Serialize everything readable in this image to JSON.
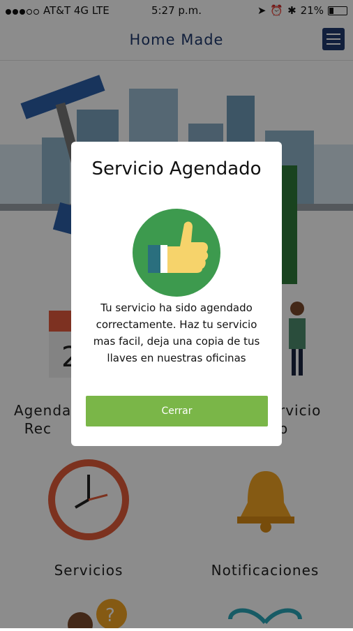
{
  "statusbar": {
    "carrier": "AT&T 4G  LTE",
    "time": "5:27 p.m.",
    "battery": "21%"
  },
  "header": {
    "title": "Home Made"
  },
  "grid": {
    "item1": "Agendar\nRec",
    "item2": "rvicio\no",
    "item3": "Servicios",
    "item4": "Notificaciones"
  },
  "modal": {
    "title": "Servicio Agendado",
    "message": "Tu servicio ha sido agendado correctamente. Haz tu servicio mas facil, deja una copia de tus llaves en nuestras oficinas",
    "button": "Cerrar"
  },
  "colors": {
    "brand": "#1f3a6e",
    "accent_green": "#7ab648",
    "badge_green": "#3d9a4e"
  },
  "icons": [
    "menu-icon",
    "thumbs-up-icon",
    "clock-icon",
    "bell-icon",
    "calendar-icon",
    "question-icon",
    "gift-icon"
  ]
}
